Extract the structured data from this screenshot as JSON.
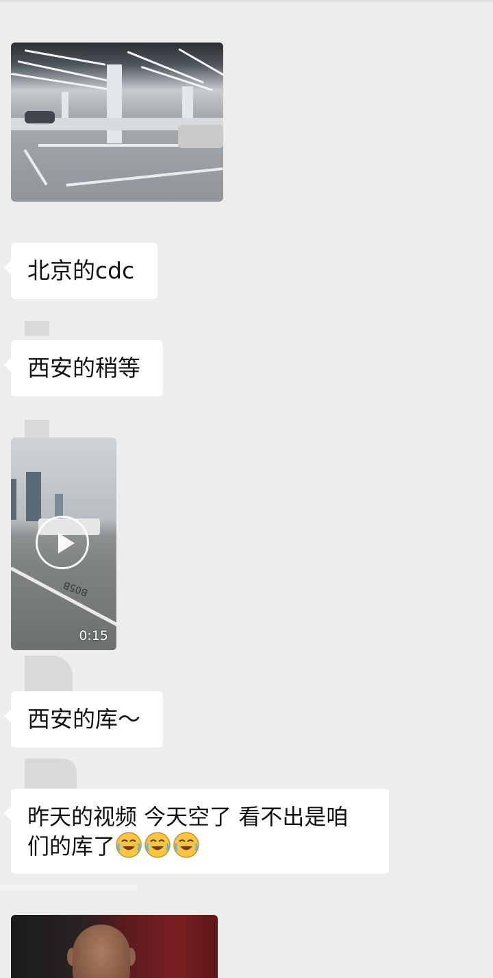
{
  "messages": [
    {
      "type": "image",
      "alt": "parking-garage-photo"
    },
    {
      "type": "text",
      "text": "北京的cdc"
    },
    {
      "type": "text",
      "text": "西安的稍等"
    },
    {
      "type": "video",
      "duration": "0:15"
    },
    {
      "type": "text",
      "text": "西安的库～"
    },
    {
      "type": "text",
      "line1": "昨天的视频 今天空了 看不出是咱",
      "line2": "们的库了",
      "emoji": "laughing-crying-emoji",
      "emoji_count": 3
    },
    {
      "type": "image",
      "alt": "person-photo"
    }
  ],
  "colors": {
    "background": "#ededed",
    "bubble": "#ffffff",
    "text": "#111111"
  }
}
